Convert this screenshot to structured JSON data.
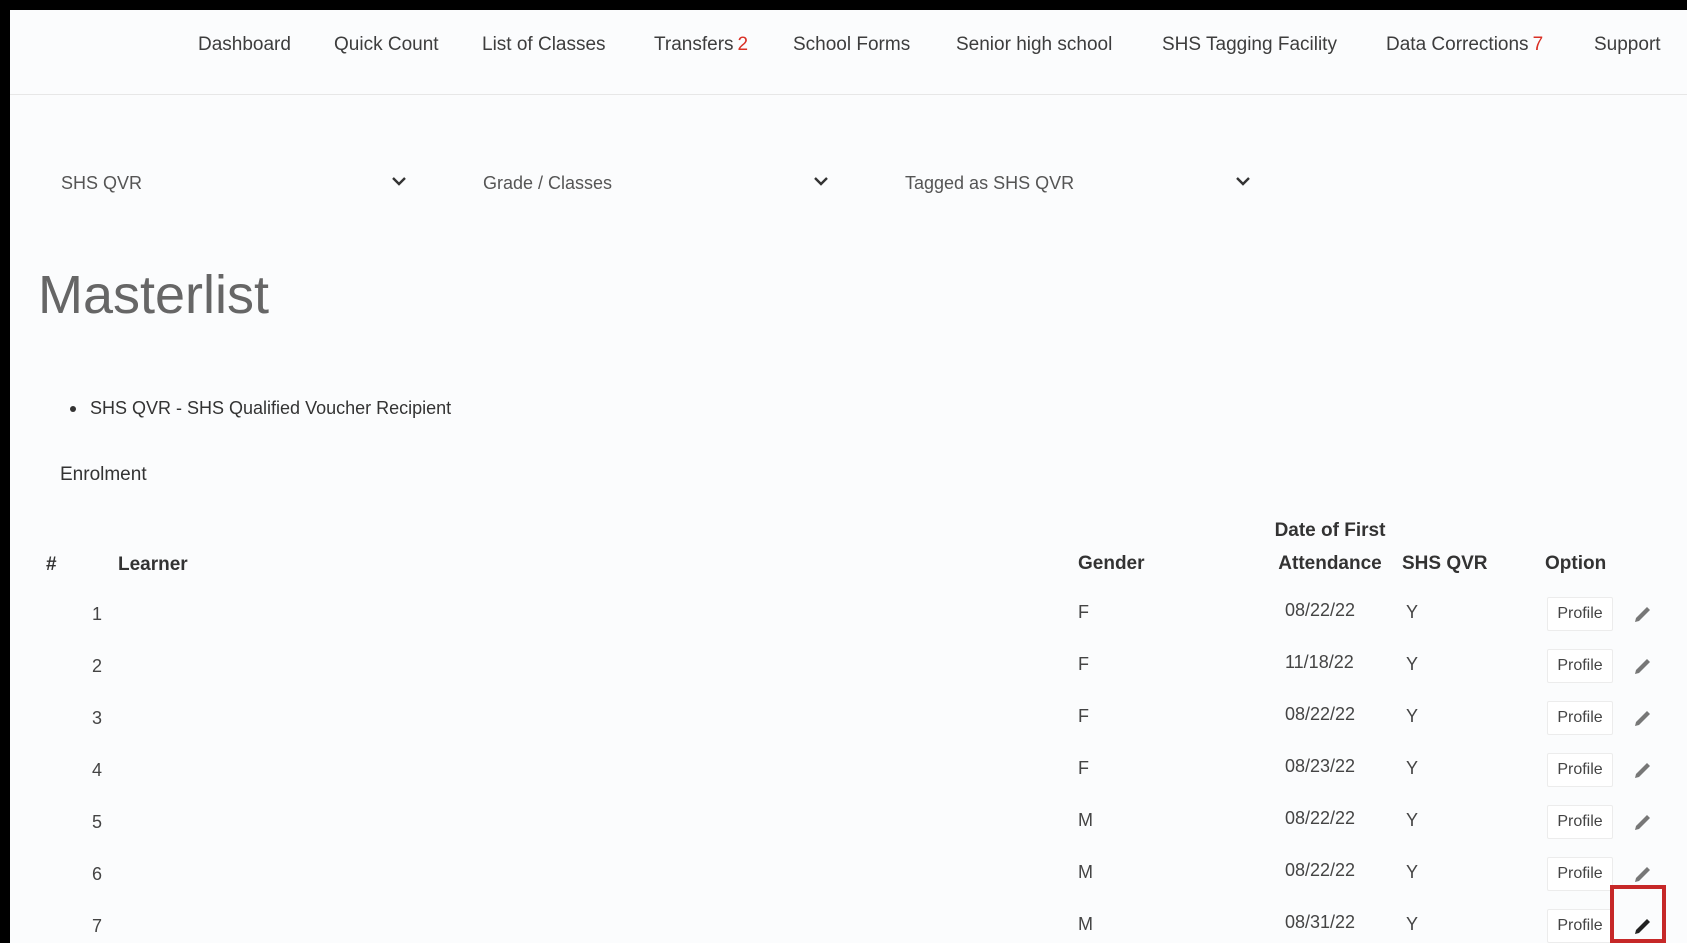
{
  "nav": {
    "items": [
      {
        "label": "Dashboard",
        "badge": ""
      },
      {
        "label": "Quick Count",
        "badge": ""
      },
      {
        "label": "List of Classes",
        "badge": ""
      },
      {
        "label": "Transfers",
        "badge": "2"
      },
      {
        "label": "School Forms",
        "badge": ""
      },
      {
        "label": "Senior high school",
        "badge": ""
      },
      {
        "label": "SHS Tagging Facility",
        "badge": ""
      },
      {
        "label": "Data Corrections",
        "badge": "7"
      },
      {
        "label": "Support",
        "badge": ""
      }
    ]
  },
  "filters": {
    "program": "SHS QVR",
    "grade": "Grade / Classes",
    "tag": "Tagged as SHS QVR"
  },
  "page_title": "Masterlist",
  "legend_items": [
    "SHS QVR - SHS Qualified Voucher Recipient"
  ],
  "section_label": "Enrolment",
  "table": {
    "headers": {
      "number": "#",
      "learner": "Learner",
      "gender": "Gender",
      "date_line1": "Date of First",
      "date_line2": "Attendance",
      "qvr": "SHS QVR",
      "option": "Option"
    },
    "profile_label": "Profile",
    "rows": [
      {
        "num": "1",
        "learner": "",
        "gender": "F",
        "date": "08/22/22",
        "qvr": "Y"
      },
      {
        "num": "2",
        "learner": "",
        "gender": "F",
        "date": "11/18/22",
        "qvr": "Y"
      },
      {
        "num": "3",
        "learner": "",
        "gender": "F",
        "date": "08/22/22",
        "qvr": "Y"
      },
      {
        "num": "4",
        "learner": "",
        "gender": "F",
        "date": "08/23/22",
        "qvr": "Y"
      },
      {
        "num": "5",
        "learner": "",
        "gender": "M",
        "date": "08/22/22",
        "qvr": "Y"
      },
      {
        "num": "6",
        "learner": "",
        "gender": "M",
        "date": "08/22/22",
        "qvr": "Y"
      },
      {
        "num": "7",
        "learner": "",
        "gender": "M",
        "date": "08/31/22",
        "qvr": "Y"
      }
    ]
  },
  "colors": {
    "badge": "#d93025",
    "highlight": "#c62828"
  }
}
